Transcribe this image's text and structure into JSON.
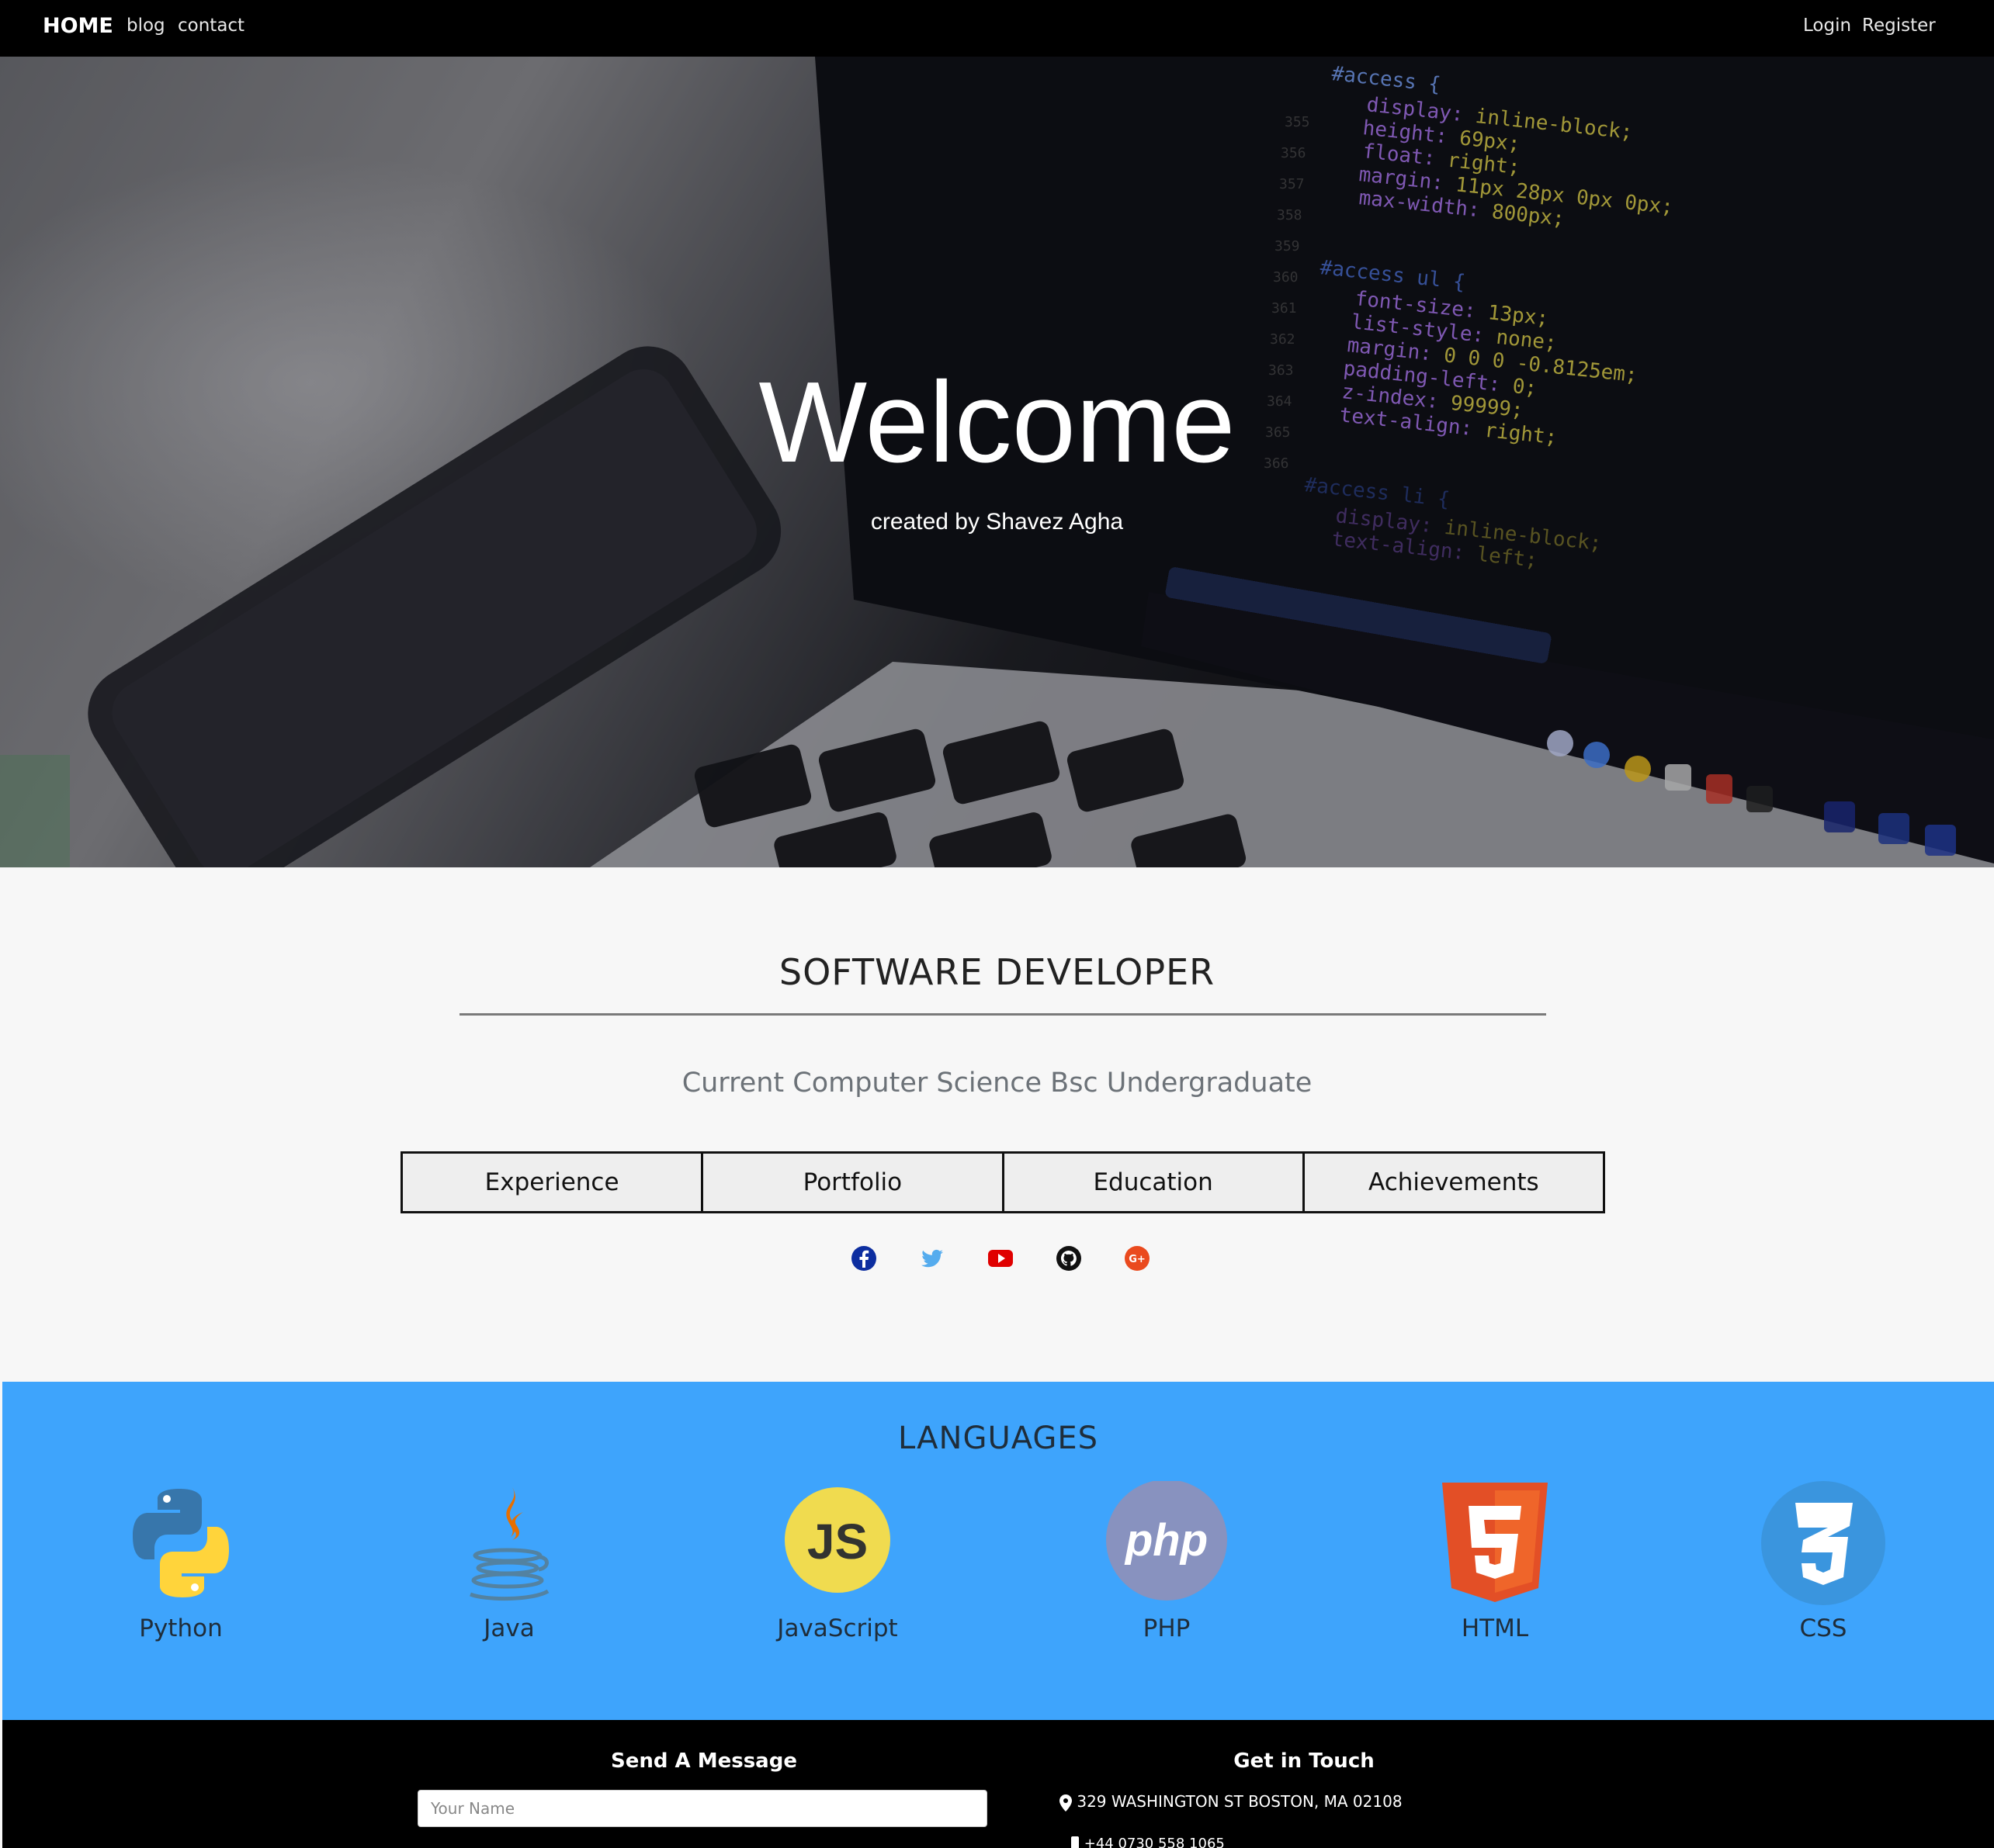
{
  "navbar": {
    "brand": "HOME",
    "links": [
      "blog",
      "contact"
    ],
    "right_links": [
      "Login",
      "Register"
    ]
  },
  "hero": {
    "title": "Welcome",
    "subtitle": "created by Shavez Agha"
  },
  "about": {
    "title": "SOFTWARE DEVELOPER",
    "subtitle": "Current Computer Science Bsc Undergraduate",
    "tabs": [
      "Experience",
      "Portfolio",
      "Education",
      "Achievements"
    ],
    "socials": [
      {
        "icon": "facebook-icon",
        "color": "#0d2ea0"
      },
      {
        "icon": "twitter-icon",
        "color": "#55acee"
      },
      {
        "icon": "youtube-icon",
        "color": "#e00000"
      },
      {
        "icon": "github-icon",
        "color": "#111111"
      },
      {
        "icon": "google-plus-icon",
        "color": "#ea4a1e"
      }
    ]
  },
  "languages": {
    "title": "LANGUAGES",
    "items": [
      {
        "label": "Python",
        "icon": "python-icon"
      },
      {
        "label": "Java",
        "icon": "java-icon"
      },
      {
        "label": "JavaScript",
        "icon": "javascript-icon",
        "badge": "JS"
      },
      {
        "label": "PHP",
        "icon": "php-icon",
        "badge": "php"
      },
      {
        "label": "HTML",
        "icon": "html5-icon",
        "badge": "5"
      },
      {
        "label": "CSS",
        "icon": "css3-icon",
        "badge": "3"
      }
    ],
    "background": "#3ea4fc"
  },
  "footer": {
    "message_title": "Send A Message",
    "name_placeholder": "Your Name",
    "touch_title": "Get in Touch",
    "address": "329 WASHINGTON ST BOSTON, MA 02108",
    "phone": "+44 0730 558 1065"
  }
}
